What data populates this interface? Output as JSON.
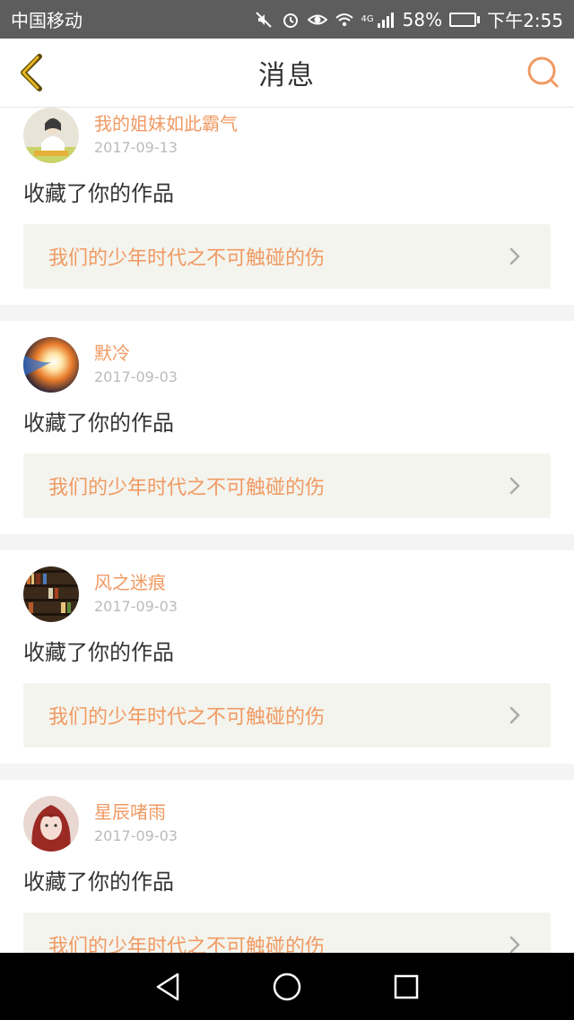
{
  "status_bar": {
    "carrier": "中国移动",
    "network": "4G",
    "battery_percent": "58%",
    "time": "下午2:55",
    "battery_level": 0.58,
    "battery_color": "#31c24a"
  },
  "header": {
    "title": "消息",
    "accent": "#f09a63"
  },
  "messages": [
    {
      "username": "我的姐妹如此霸气",
      "date": "2017-09-13",
      "action": "收藏了你的作品",
      "work_title": "我们的少年时代之不可触碰的伤",
      "avatar": "anime-girl"
    },
    {
      "username": "默冷",
      "date": "2017-09-03",
      "action": "收藏了你的作品",
      "work_title": "我们的少年时代之不可触碰的伤",
      "avatar": "light-burst"
    },
    {
      "username": "风之迷痕",
      "date": "2017-09-03",
      "action": "收藏了你的作品",
      "work_title": "我们的少年时代之不可触碰的伤",
      "avatar": "bookshelf"
    },
    {
      "username": "星辰啫雨",
      "date": "2017-09-03",
      "action": "收藏了你的作品",
      "work_title": "我们的少年时代之不可触碰的伤",
      "avatar": "red-hair-girl"
    }
  ]
}
